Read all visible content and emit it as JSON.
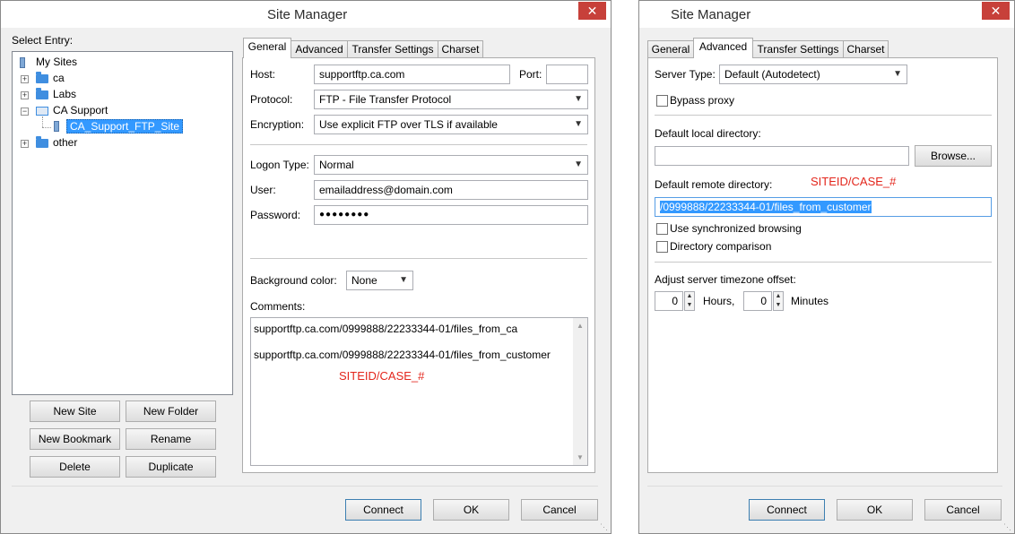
{
  "left": {
    "title": "Site Manager",
    "close": "✕",
    "select_entry": "Select Entry:",
    "tree": {
      "root": "My Sites",
      "ca": "ca",
      "labs": "Labs",
      "ca_support": "CA Support",
      "site": "CA_Support_FTP_Site",
      "other": "other"
    },
    "buttons": {
      "new_site": "New Site",
      "new_folder": "New Folder",
      "new_bookmark": "New Bookmark",
      "rename": "Rename",
      "delete": "Delete",
      "duplicate": "Duplicate"
    },
    "tabs": [
      "General",
      "Advanced",
      "Transfer Settings",
      "Charset"
    ],
    "host_label": "Host:",
    "host_value": "supportftp.ca.com",
    "port_label": "Port:",
    "port_value": "",
    "protocol_label": "Protocol:",
    "protocol_value": "FTP - File Transfer Protocol",
    "encryption_label": "Encryption:",
    "encryption_value": "Use explicit FTP over TLS if available",
    "logon_label": "Logon Type:",
    "logon_value": "Normal",
    "user_label": "User:",
    "user_value": "emailaddress@domain.com",
    "password_label": "Password:",
    "password_value": "●●●●●●●●",
    "bg_label": "Background color:",
    "bg_value": "None",
    "comments_label": "Comments:",
    "comment_line1": "supportftp.ca.com/0999888/22233344-01/files_from_ca",
    "comment_line2": "supportftp.ca.com/0999888/22233344-01/files_from_customer",
    "annotation": "SITEID/CASE_#",
    "connect": "Connect",
    "ok": "OK",
    "cancel": "Cancel"
  },
  "right": {
    "title": "Site Manager",
    "close": "✕",
    "tabs": [
      "General",
      "Advanced",
      "Transfer Settings",
      "Charset"
    ],
    "server_type_label": "Server Type:",
    "server_type_value": "Default (Autodetect)",
    "bypass_proxy": "Bypass proxy",
    "local_dir_label": "Default local directory:",
    "local_dir_value": "",
    "browse": "Browse...",
    "remote_dir_label": "Default remote directory:",
    "annotation": "SITEID/CASE_#",
    "remote_dir_value": "/0999888/22233344-01/files_from_customer",
    "sync_browsing": "Use synchronized browsing",
    "dir_comparison": "Directory comparison",
    "timezone_label": "Adjust server timezone offset:",
    "hours_value": "0",
    "hours_label": "Hours,",
    "minutes_value": "0",
    "minutes_label": "Minutes",
    "connect": "Connect",
    "ok": "OK",
    "cancel": "Cancel"
  },
  "colors": {
    "close_red": "#c7403a",
    "annotation_red": "#e3261c",
    "selection_blue": "#3399ff",
    "folder_blue": "#3f8ee0"
  }
}
